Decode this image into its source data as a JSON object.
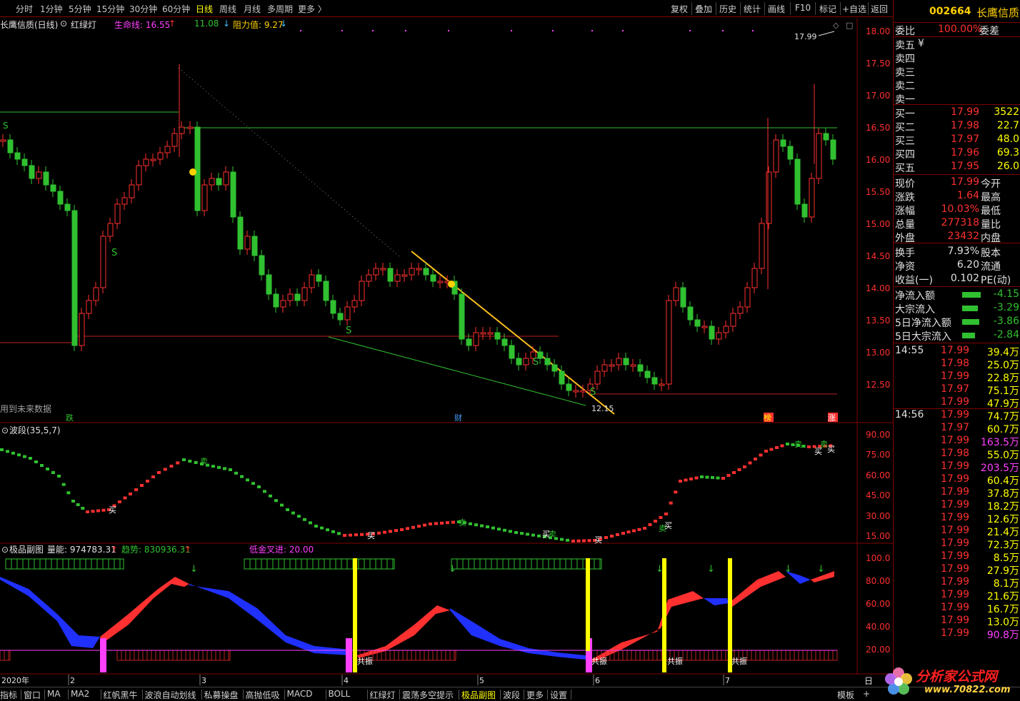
{
  "toolbar": {
    "periods": [
      "分时",
      "1分钟",
      "5分钟",
      "15分钟",
      "30分钟",
      "60分钟",
      "日线",
      "周线",
      "月线",
      "多周期",
      "更多 〉"
    ],
    "active_period": "日线",
    "tools": [
      "复权",
      "叠加",
      "历史",
      "统计",
      "画线",
      "F10",
      "标记",
      "+自选",
      "返回"
    ]
  },
  "main_chart": {
    "title": "长鹰信质(日线)",
    "indicator": "红绿灯",
    "life_line_label": "生命线: 16.55",
    "support_label": "11.08",
    "resist_label": "阻力值: 9.27",
    "y_ticks": [
      "18.00",
      "17.50",
      "17.00",
      "16.50",
      "16.00",
      "15.50",
      "15.00",
      "14.50",
      "14.00",
      "13.50",
      "13.00",
      "12.50"
    ],
    "high_label": "17.99",
    "low_label": "12.15",
    "future_note": "用到未来数据",
    "markers": [
      "跌",
      "财",
      "榜",
      "涨"
    ]
  },
  "band_chart": {
    "title": "波段(35,5,7)",
    "y_ticks": [
      "90.00",
      "75.00",
      "60.00",
      "45.00",
      "30.00",
      "15.00"
    ]
  },
  "sub_chart": {
    "title": "极品副图",
    "energy_label": "量能: 974783.31",
    "trend_label": "趋势: 830936.31",
    "golden_label": "低金叉进: 20.00",
    "y_ticks": [
      "100.0",
      "80.00",
      "60.00",
      "40.00",
      "20.00"
    ],
    "resonance": "共振"
  },
  "date_axis": [
    "2020年",
    "2",
    "3",
    "4",
    "5",
    "6",
    "7"
  ],
  "stock": {
    "code": "002664",
    "name": "长鹰信质"
  },
  "order_book": {
    "ratio_label": "委比",
    "ratio_value": "100.00%",
    "diff_label": "委差",
    "sells": [
      {
        "label": "卖五",
        "price": "¥",
        "vol": ""
      },
      {
        "label": "卖四",
        "price": "",
        "vol": ""
      },
      {
        "label": "卖三",
        "price": "",
        "vol": ""
      },
      {
        "label": "卖二",
        "price": "",
        "vol": ""
      },
      {
        "label": "卖一",
        "price": "",
        "vol": ""
      }
    ],
    "buys": [
      {
        "label": "买一",
        "price": "17.99",
        "vol": "3522"
      },
      {
        "label": "买二",
        "price": "17.98",
        "vol": "22.7"
      },
      {
        "label": "买三",
        "price": "17.97",
        "vol": "48.0"
      },
      {
        "label": "买四",
        "price": "17.96",
        "vol": "69.3"
      },
      {
        "label": "买五",
        "price": "17.95",
        "vol": "26.0"
      }
    ]
  },
  "quote": [
    {
      "l": "现价",
      "v": "17.99",
      "r": "今开"
    },
    {
      "l": "涨跌",
      "v": "1.64",
      "r": "最高"
    },
    {
      "l": "涨幅",
      "v": "10.03%",
      "r": "最低"
    },
    {
      "l": "总量",
      "v": "277318",
      "r": "量比"
    },
    {
      "l": "外盘",
      "v": "23432",
      "r": "内盘"
    }
  ],
  "quote2": [
    {
      "l": "换手",
      "v": "7.93%",
      "r": "股本"
    },
    {
      "l": "净资",
      "v": "6.20",
      "r": "流通"
    },
    {
      "l": "收益(一)",
      "v": "0.102",
      "r": "PE(动)"
    }
  ],
  "flows": [
    {
      "l": "净流入额",
      "v": "-4.15"
    },
    {
      "l": "大宗流入",
      "v": "-3.29"
    },
    {
      "l": "5日净流入额",
      "v": "-3.86"
    },
    {
      "l": "5日大宗流入",
      "v": "-2.84"
    }
  ],
  "ticks": [
    {
      "t": "14:55",
      "p": "17.99",
      "v": "39.4万"
    },
    {
      "t": "",
      "p": "17.98",
      "v": "25.0万"
    },
    {
      "t": "",
      "p": "17.99",
      "v": "22.8万"
    },
    {
      "t": "",
      "p": "17.97",
      "v": "75.1万"
    },
    {
      "t": "",
      "p": "17.99",
      "v": "47.9万"
    },
    {
      "t": "14:56",
      "p": "17.99",
      "v": "74.7万"
    },
    {
      "t": "",
      "p": "17.97",
      "v": "60.7万"
    },
    {
      "t": "",
      "p": "17.99",
      "v": "163.5万"
    },
    {
      "t": "",
      "p": "17.98",
      "v": "55.0万"
    },
    {
      "t": "",
      "p": "17.99",
      "v": "203.5万"
    },
    {
      "t": "",
      "p": "17.99",
      "v": "60.4万"
    },
    {
      "t": "",
      "p": "17.99",
      "v": "37.8万"
    },
    {
      "t": "",
      "p": "17.99",
      "v": "18.2万"
    },
    {
      "t": "",
      "p": "17.99",
      "v": "12.6万"
    },
    {
      "t": "",
      "p": "17.99",
      "v": "21.4万"
    },
    {
      "t": "",
      "p": "17.99",
      "v": "72.3万"
    },
    {
      "t": "",
      "p": "17.99",
      "v": "8.5万"
    },
    {
      "t": "",
      "p": "17.99",
      "v": "27.9万"
    },
    {
      "t": "",
      "p": "17.99",
      "v": "8.1万"
    },
    {
      "t": "",
      "p": "17.99",
      "v": "21.6万"
    },
    {
      "t": "",
      "p": "17.99",
      "v": "16.7万"
    },
    {
      "t": "",
      "p": "17.99",
      "v": "13.0万"
    },
    {
      "t": "",
      "p": "17.99",
      "v": "90.8万"
    }
  ],
  "bottom_tabs": [
    "指标",
    "窗口",
    "MA",
    "MA2",
    "红帆黑牛",
    "波浪自动划线",
    "私募操盘",
    "高抛低吸",
    "MACD",
    "BOLL",
    "红绿灯",
    "震荡多空提示",
    "极品副图",
    "波段",
    "更多",
    "设置"
  ],
  "active_bottom_tab": "极品副图",
  "bottom_right": [
    "模板",
    "+"
  ],
  "day_label": "日",
  "logo": {
    "text": "分析家公式网",
    "url": "www.70822.com"
  },
  "colors": {
    "up": "#ff3030",
    "down": "#30c030",
    "accent": "#ffff00",
    "border": "#800000"
  }
}
